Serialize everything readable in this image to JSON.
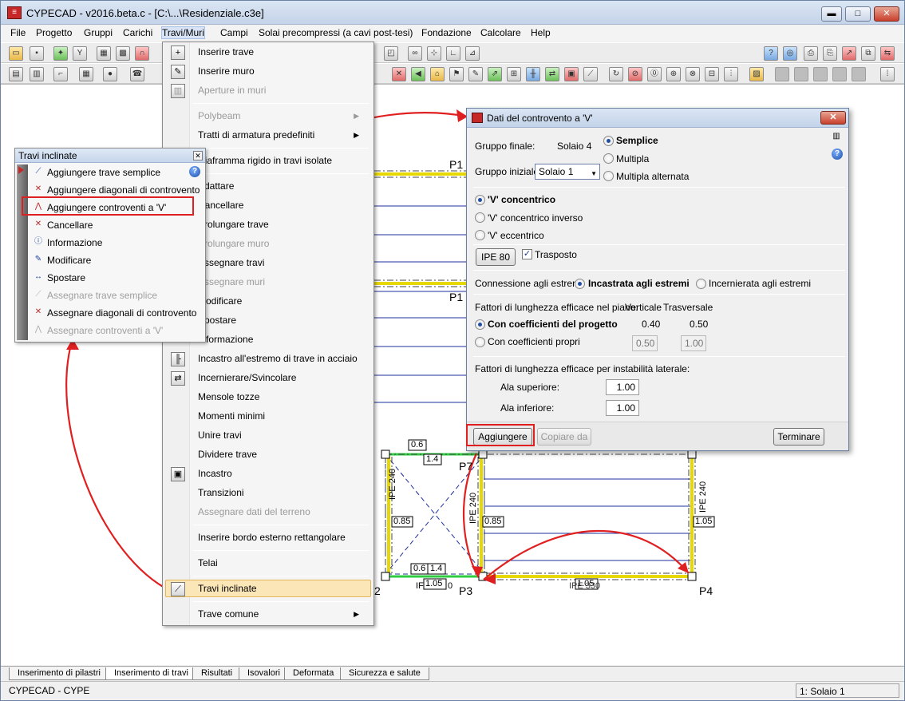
{
  "window": {
    "title": "CYPECAD - v2016.beta.c - [C:\\...\\Residenziale.c3e]",
    "buttons": {
      "minimize": "▬",
      "maximize": "□",
      "close": "✕"
    }
  },
  "menubar": [
    "File",
    "Progetto",
    "Gruppi",
    "Carichi",
    "Travi/Muri",
    "Campi",
    "Solai precompressi (a cavi post-tesi)",
    "Fondazione",
    "Calcolare",
    "Help"
  ],
  "dropdown": {
    "items": [
      {
        "label": "Inserire trave"
      },
      {
        "label": "Inserire muro"
      },
      {
        "label": "Aperture in muri",
        "disabled": true
      },
      {
        "label": "Polybeam",
        "disabled": true,
        "submenu": true
      },
      {
        "label": "Tratti di armatura predefiniti",
        "submenu": true
      },
      {
        "label": "Diaframma rigido in travi isolate"
      },
      {
        "label": "Adattare"
      },
      {
        "label": "Cancellare"
      },
      {
        "label": "Prolungare trave"
      },
      {
        "label": "Prolungare muro",
        "disabled": true
      },
      {
        "label": "Assegnare travi"
      },
      {
        "label": "Assegnare muri",
        "disabled": true
      },
      {
        "label": "Modificare"
      },
      {
        "label": "Spostare"
      },
      {
        "label": "Informazione"
      },
      {
        "label": "Incastro all'estremo di trave in acciaio"
      },
      {
        "label": "Incernierare/Svincolare"
      },
      {
        "label": "Mensole tozze"
      },
      {
        "label": "Momenti minimi"
      },
      {
        "label": "Unire travi"
      },
      {
        "label": "Dividere trave"
      },
      {
        "label": "Incastro"
      },
      {
        "label": "Transizioni"
      },
      {
        "label": "Assegnare dati del terreno",
        "disabled": true
      },
      {
        "label": "Inserire bordo esterno rettangolare"
      },
      {
        "label": "Telai"
      },
      {
        "label": "Travi inclinate",
        "highlighted": true
      },
      {
        "label": "Trave comune",
        "submenu": true
      }
    ]
  },
  "palette": {
    "title": "Travi inclinate",
    "items": [
      {
        "label": "Aggiungere trave semplice"
      },
      {
        "label": "Aggiungere diagonali di controvento"
      },
      {
        "label": "Aggiungere controventi a 'V'"
      },
      {
        "label": "Cancellare"
      },
      {
        "label": "Informazione"
      },
      {
        "label": "Modificare"
      },
      {
        "label": "Spostare"
      },
      {
        "label": "Assegnare trave semplice",
        "disabled": true
      },
      {
        "label": "Assegnare diagonali di controvento"
      },
      {
        "label": "Assegnare controventi a 'V'",
        "disabled": true
      }
    ]
  },
  "dialog": {
    "title": "Dati del controvento a 'V'",
    "gruppo_finale_label": "Gruppo finale:",
    "gruppo_finale_value": "Solaio 4",
    "gruppo_iniziale_label": "Gruppo iniziale:",
    "gruppo_iniziale_value": "Solaio 1",
    "mode_options": [
      "Semplice",
      "Multipla",
      "Multipla alternata"
    ],
    "mode_selected": "Semplice",
    "v_options": [
      "'V' concentrico",
      "'V' concentrico inverso",
      "'V' eccentrico"
    ],
    "v_selected": "'V' concentrico",
    "profile_button": "IPE 80",
    "trasposto_label": "Trasposto",
    "trasposto_checked": true,
    "connessione_label": "Connessione agli estremi:",
    "connessione_options": [
      "Incastrata agli estremi",
      "Incernierata agli estremi"
    ],
    "connessione_selected": "Incastrata agli estremi",
    "fattori_piano_label": "Fattori di lunghezza efficace nel piano:",
    "verticale_label": "Verticale",
    "trasversale_label": "Trasversale",
    "coeff_progetto_label": "Con coefficienti del progetto",
    "coeff_progetto_vert": "0.40",
    "coeff_progetto_trasv": "0.50",
    "coeff_propri_label": "Con coefficienti propri",
    "coeff_propri_vert": "0.50",
    "coeff_propri_trasv": "1.00",
    "fattori_laterale_label": "Fattori di lunghezza efficace per instabilità laterale:",
    "ala_superiore_label": "Ala superiore:",
    "ala_superiore_value": "1.00",
    "ala_inferiore_label": "Ala inferiore:",
    "ala_inferiore_value": "1.00",
    "aggiungere_button": "Aggiungere",
    "copiare_button": "Copiare da",
    "terminare_button": "Terminare"
  },
  "drawing": {
    "labels": {
      "p1a": "P1",
      "p1b": "P1",
      "p3": "P3",
      "p4": "P4",
      "p7": "P7",
      "p2": "2",
      "d06a": "0.6",
      "d14a": "1.4",
      "d06b": "0.6",
      "d14b": "1.4",
      "d085a": "0.85",
      "d085b": "0.85",
      "d105a": "1.05",
      "d105b": "1.05",
      "d105c": "1.05",
      "ipe240a": "IPE 240",
      "ipe240b": "IPE 240",
      "ipe240c": "IPE 240",
      "ife": "IF",
      "ipe_bottom": "IPE 330",
      "zero": "0"
    }
  },
  "tabs": [
    "Inserimento di pilastri",
    "Inserimento di travi",
    "Risultati",
    "Isovalori",
    "Deformata",
    "Sicurezza e salute"
  ],
  "tabs_active": "Inserimento di travi",
  "status": {
    "left": "CYPECAD - CYPE",
    "right": "1: Solaio 1"
  },
  "colors": {
    "accent_red": "#e02020",
    "beam_yellow": "#f2e400",
    "line_blue": "#1f2f9f"
  }
}
